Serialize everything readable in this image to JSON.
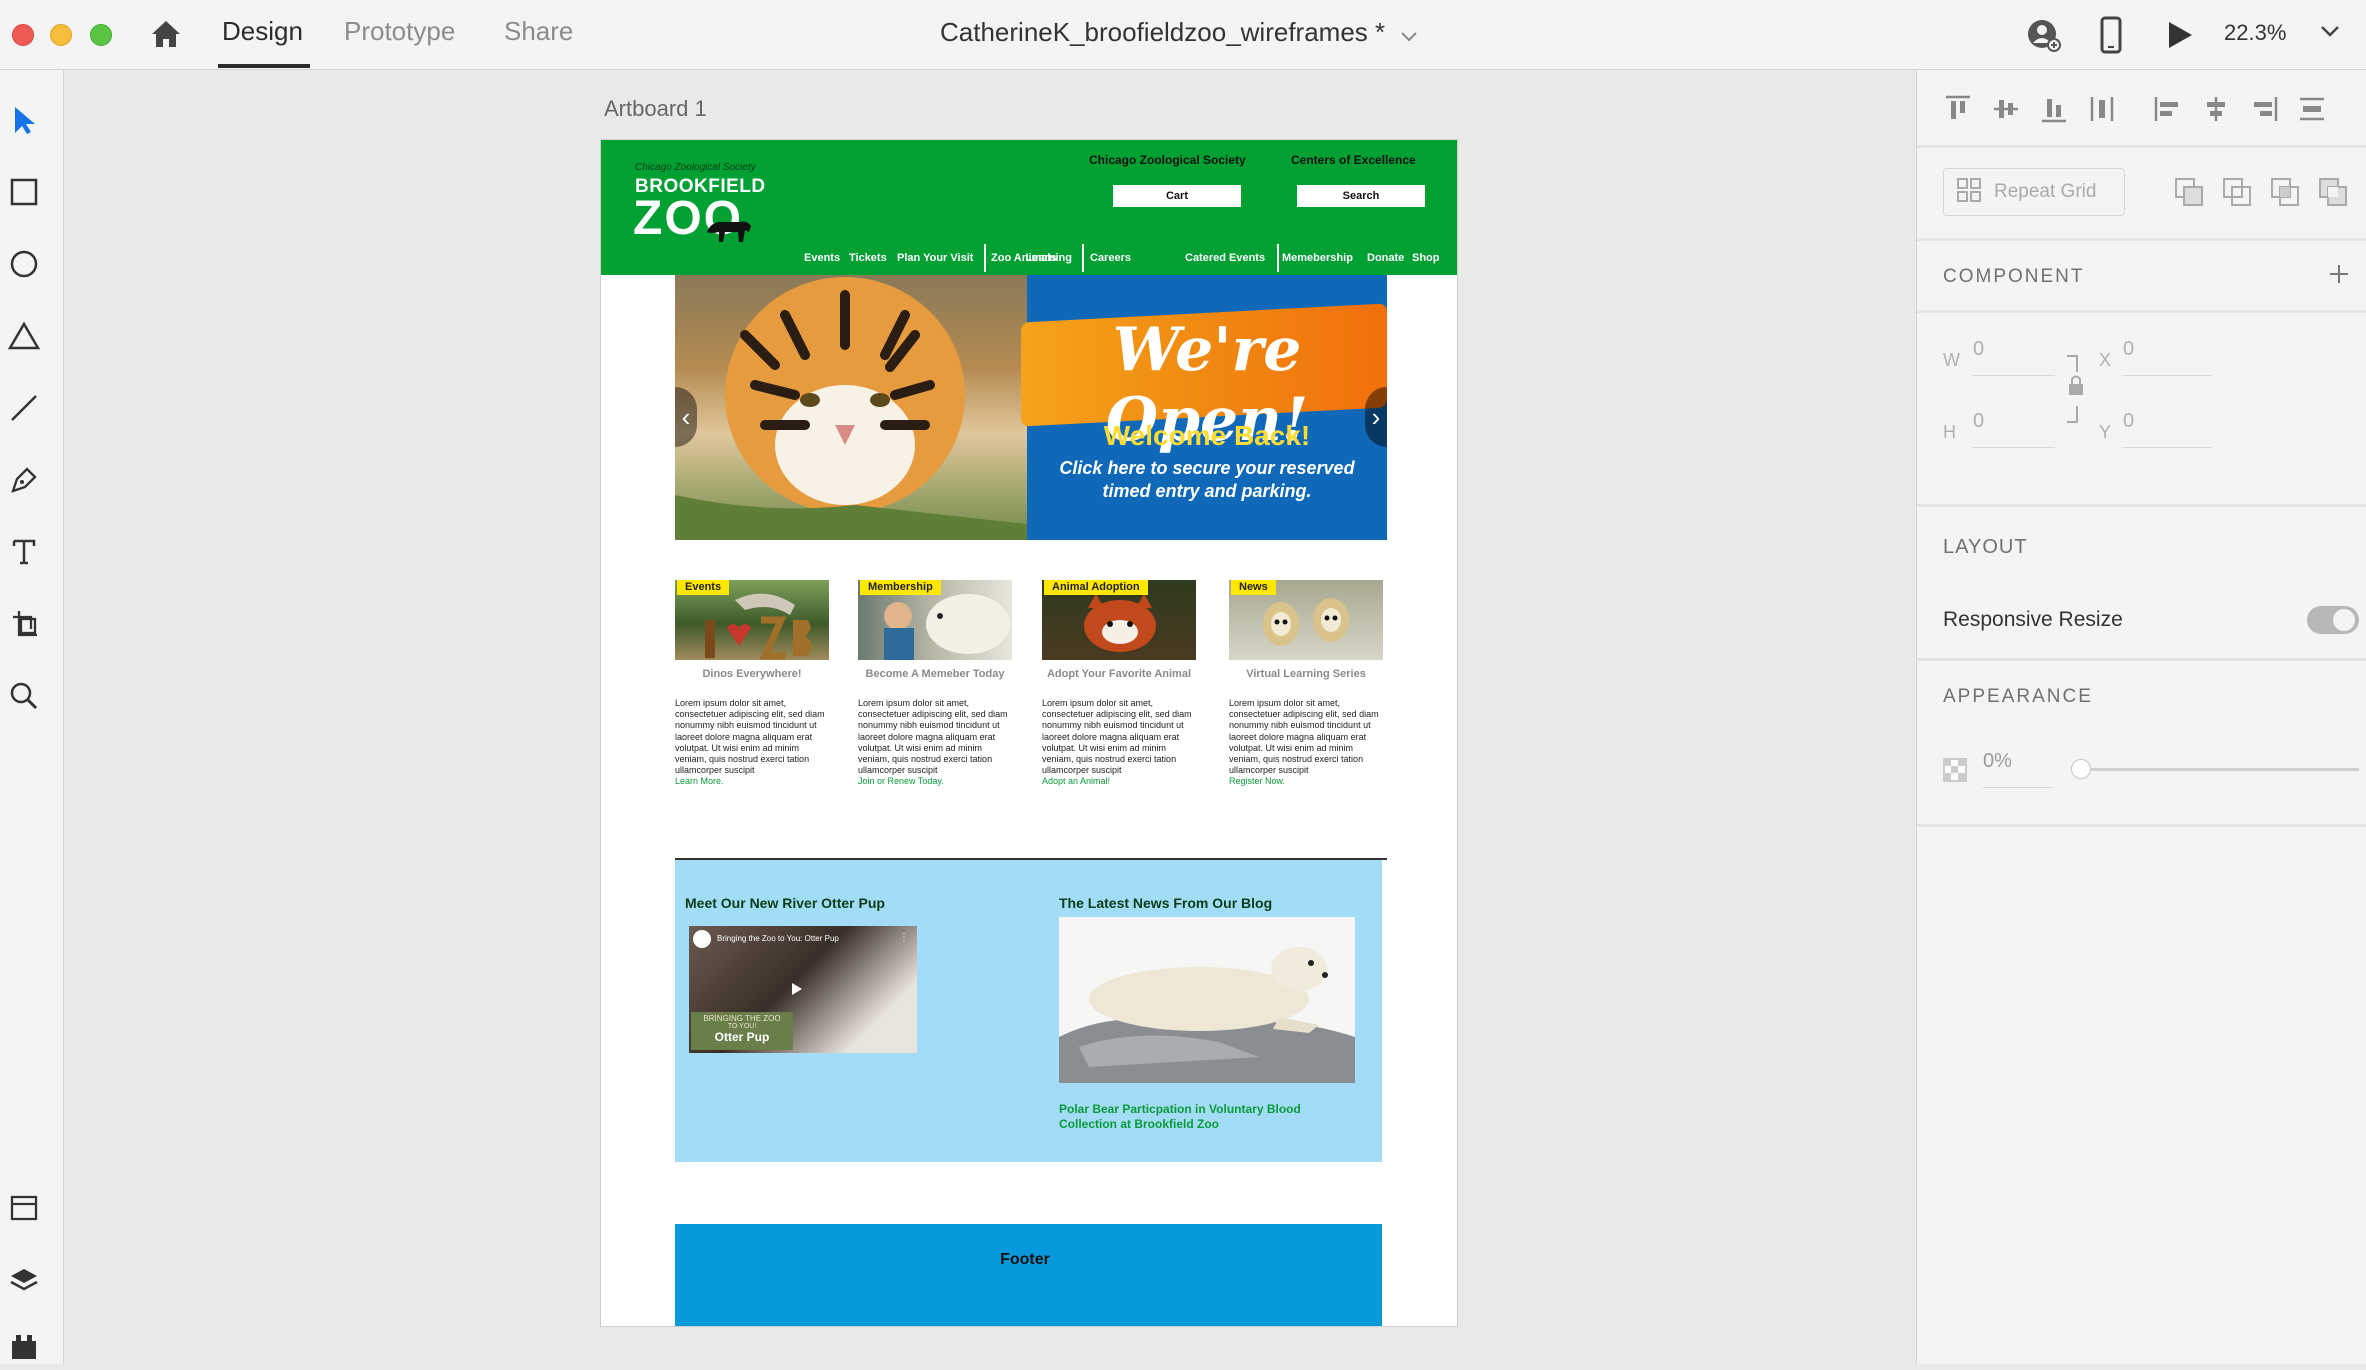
{
  "app": {
    "tabs": [
      "Design",
      "Prototype",
      "Share"
    ],
    "document_title": "CatherineK_broofieldzoo_wireframes *",
    "zoom": "22.3%"
  },
  "canvas": {
    "artboard_label": "Artboard 1"
  },
  "panel": {
    "repeat_grid": "Repeat Grid",
    "component_label": "COMPONENT",
    "w_label": "W",
    "w_value": "0",
    "h_label": "H",
    "h_value": "0",
    "x_label": "X",
    "x_value": "0",
    "y_label": "Y",
    "y_value": "0",
    "layout_label": "LAYOUT",
    "responsive_resize": "Responsive Resize",
    "appearance_label": "APPEARANCE",
    "opacity_value": "0%",
    "opacity_fraction": 0
  },
  "site": {
    "logo_small": "Chicago Zoological Society",
    "logo_brookfield": "BROOKFIELD",
    "logo_zoo": "ZOO",
    "header_links": [
      "Chicago Zoological Society",
      "Centers of Excellence"
    ],
    "cart_button": "Cart",
    "search_button": "Search",
    "nav": [
      "Events",
      "Tickets",
      "Plan Your Visit",
      "Zoo Animals",
      "Learning",
      "Careers",
      "Catered Events",
      "Memebership",
      "Donate",
      "Shop"
    ],
    "hero": {
      "headline": "We're Open!",
      "subhead": "Welcome Back!",
      "body_line1": "Click here to secure your reserved",
      "body_line2": "timed entry and parking."
    },
    "cards": [
      {
        "badge": "Events",
        "subtitle": "Dinos Everywhere!",
        "link": "Learn More."
      },
      {
        "badge": "Membership",
        "subtitle": "Become A Memeber Today",
        "link": "Join or Renew Today."
      },
      {
        "badge": "Animal Adoption",
        "subtitle": "Adopt Your Favorite Animal",
        "link": "Adopt an Animal!"
      },
      {
        "badge": "News",
        "subtitle": "Virtual Learning Series",
        "link": "Register Now."
      }
    ],
    "lorem": "Lorem ipsum dolor sit amet, consectetuer adipiscing elit, sed diam nonummy nibh euismod tincidunt ut laoreet dolore magna aliquam erat volutpat. Ut wisi enim ad minim veniam, quis nostrud exerci tation ullamcorper suscipit",
    "otter": {
      "heading": "Meet Our New River Otter Pup",
      "video_title": "Bringing the Zoo to You: Otter Pup",
      "overlay_line1": "BRINGING THE ZOO",
      "overlay_line2": "TO YOU!",
      "overlay_line3": "Otter Pup"
    },
    "blog": {
      "heading": "The Latest News From Our Blog",
      "caption_line1": "Polar Bear Particpation in Voluntary Blood",
      "caption_line2": "Collection at Brookfield Zoo"
    },
    "footer": "Footer"
  },
  "colors": {
    "brand_green": "#00a033",
    "hero_orange": "#f08a12",
    "hero_blue": "#1068b8",
    "badge_yellow": "#ffe800",
    "section_light_blue": "#a3dcf7",
    "footer_blue": "#0899dc",
    "tool_blue": "#1473e6"
  }
}
